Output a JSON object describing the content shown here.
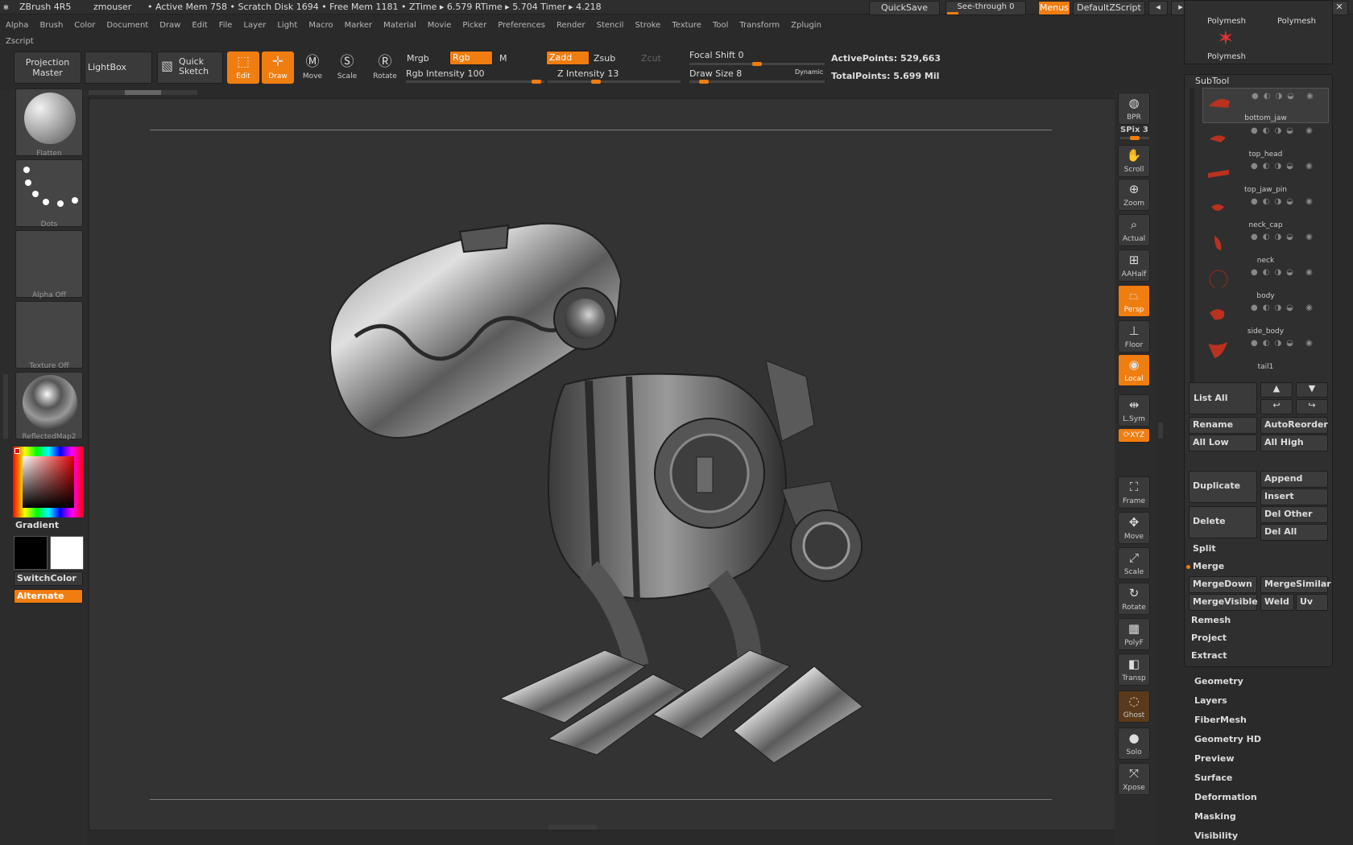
{
  "title_bar": {
    "app": "ZBrush 4R5",
    "user": "zmouser",
    "stats": "• Active Mem 758 • Scratch Disk 1694 • Free Mem 1181 • ZTime ▸ 6.579 RTime ▸ 5.704 Timer ▸ 4.218",
    "quicksave": "QuickSave",
    "see_through": "See-through  0",
    "menus": "Menus",
    "script": "DefaultZScript"
  },
  "menu": [
    "Alpha",
    "Brush",
    "Color",
    "Document",
    "Draw",
    "Edit",
    "File",
    "Layer",
    "Light",
    "Macro",
    "Marker",
    "Material",
    "Movie",
    "Picker",
    "Preferences",
    "Render",
    "Stencil",
    "Stroke",
    "Texture",
    "Tool",
    "Transform",
    "Zplugin",
    "Zscript"
  ],
  "toolbar": {
    "projection_master": "Projection Master",
    "lightbox": "LightBox",
    "quick_sketch": "Quick Sketch",
    "edit": "Edit",
    "draw": "Draw",
    "move": "Move",
    "scale": "Scale",
    "rotate": "Rotate",
    "mrgb": "Mrgb",
    "rgb": "Rgb",
    "m": "M",
    "rgb_intensity": "Rgb Intensity 100",
    "zadd": "Zadd",
    "zsub": "Zsub",
    "zcut": "Zcut",
    "z_intensity": "Z Intensity 13",
    "focal_shift": "Focal Shift 0",
    "draw_size": "Draw Size 8",
    "dynamic": "Dynamic",
    "active_points": "ActivePoints: 529,663",
    "total_points": "TotalPoints: 5.699 Mil",
    "rgb_intensity_value": 100,
    "z_intensity_value": 13
  },
  "left_shelf": {
    "flatten": "Flatten",
    "dots": "Dots",
    "alpha": "Alpha  Off",
    "texture": "Texture  Off",
    "material": "ReflectedMap2",
    "gradient": "Gradient",
    "switch_color": "SwitchColor",
    "alternate": "Alternate",
    "colors": {
      "main": "#000000",
      "secondary": "#ffffff",
      "accent": "#f07d0f"
    }
  },
  "right_shelf": [
    {
      "label": "BPR",
      "icon": "bpr-icon"
    },
    {
      "label": "Scroll",
      "icon": "hand-icon"
    },
    {
      "label": "Zoom",
      "icon": "zoom-icon"
    },
    {
      "label": "Actual",
      "icon": "actual-icon"
    },
    {
      "label": "AAHalf",
      "icon": "aahalf-icon"
    },
    {
      "label": "Persp",
      "icon": "persp-icon"
    },
    {
      "label": "Floor",
      "icon": "floor-icon"
    },
    {
      "label": "Local",
      "icon": "local-icon"
    },
    {
      "label": "L.Sym",
      "icon": "lsym-icon"
    },
    {
      "label": "XYZ",
      "icon": "xyz-icon"
    },
    {
      "label": "Frame",
      "icon": "frame-icon"
    },
    {
      "label": "Move",
      "icon": "move-icon"
    },
    {
      "label": "Scale",
      "icon": "scale-icon"
    },
    {
      "label": "Rotate",
      "icon": "rotate-icon"
    },
    {
      "label": "PolyF",
      "icon": "polyf-icon"
    },
    {
      "label": "Transp",
      "icon": "transp-icon"
    },
    {
      "label": "Ghost",
      "icon": "ghost-icon"
    },
    {
      "label": "Solo",
      "icon": "solo-icon"
    },
    {
      "label": "Xpose",
      "icon": "xpose-icon"
    }
  ],
  "spix": "SPix 3",
  "tool_palette": {
    "polymesh": "Polymesh",
    "subtool_title": "SubTool",
    "subtools": [
      "bottom_jaw",
      "top_head",
      "top_jaw_pin",
      "neck_cap",
      "neck",
      "body",
      "side_body",
      "tail1"
    ],
    "list_all": "List All",
    "rename": "Rename",
    "auto_reorder": "AutoReorder",
    "all_low": "All Low",
    "all_high": "All High",
    "duplicate": "Duplicate",
    "append": "Append",
    "insert": "Insert",
    "delete": "Delete",
    "del_other": "Del Other",
    "del_all": "Del All",
    "split": "Split",
    "merge": "Merge",
    "merge_down": "MergeDown",
    "merge_similar": "MergeSimilar",
    "merge_visible": "MergeVisible",
    "weld": "Weld",
    "uv": "Uv",
    "remesh": "Remesh",
    "project": "Project",
    "extract": "Extract",
    "sections": [
      "Geometry",
      "Layers",
      "FiberMesh",
      "Geometry HD",
      "Preview",
      "Surface",
      "Deformation",
      "Masking",
      "Visibility"
    ]
  }
}
